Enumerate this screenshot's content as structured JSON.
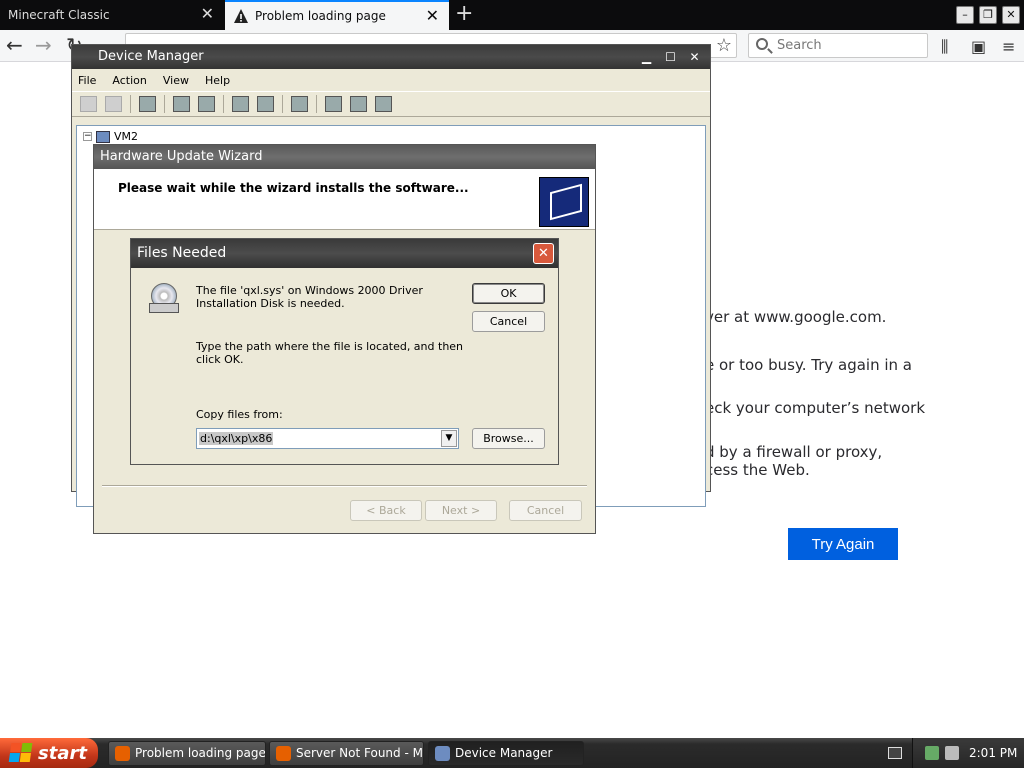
{
  "browser": {
    "tabs": [
      {
        "label": "Minecraft Classic"
      },
      {
        "label": "Problem loading page"
      }
    ],
    "url_text": "",
    "search_placeholder": "Search"
  },
  "error_page": {
    "lines": [
      "ver at www.google.com.",
      "e or too busy. Try again in a",
      "eck your computer’s network",
      "d by a firewall or proxy,",
      "cess the Web."
    ],
    "try_again_label": "Try Again"
  },
  "device_manager": {
    "title": "Device Manager",
    "menu": [
      "File",
      "Action",
      "View",
      "Help"
    ],
    "tree_root": "VM2"
  },
  "wizard": {
    "title": "Hardware Update Wizard",
    "message": "Please wait while the wizard installs the software...",
    "back_label": "< Back",
    "next_label": "Next >",
    "cancel_label": "Cancel"
  },
  "files_needed": {
    "title": "Files Needed",
    "message1": "The file 'qxl.sys' on Windows 2000 Driver Installation Disk is needed.",
    "message2": "Type the path where the file is located, and then click OK.",
    "copy_label": "Copy files from:",
    "copy_value": "d:\\qxl\\xp\\x86",
    "ok_label": "OK",
    "cancel_label": "Cancel",
    "browse_label": "Browse..."
  },
  "taskbar": {
    "start_label": "start",
    "items": [
      {
        "label": "Problem loading page..."
      },
      {
        "label": "Server Not Found - M..."
      },
      {
        "label": "Device Manager"
      }
    ],
    "clock": "2:01 PM"
  },
  "colors": {
    "firefox_accent": "#0a84ff",
    "try_again_bg": "#0060df",
    "start_button": "#c2361a",
    "close_button": "#d8593c"
  }
}
